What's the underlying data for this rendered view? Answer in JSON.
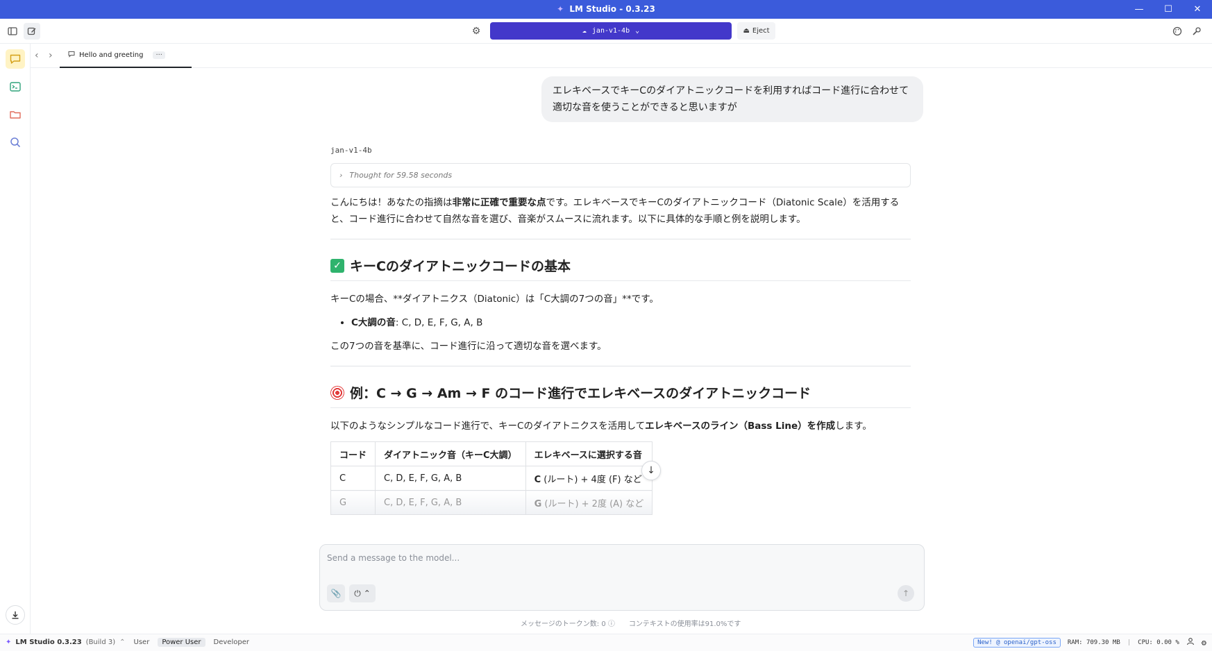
{
  "window": {
    "title": "LM Studio - 0.3.23"
  },
  "toolbar": {
    "model_name": "jan-v1-4b",
    "eject_label": "Eject"
  },
  "tab": {
    "title": "Hello and greeting",
    "more": "···"
  },
  "chat": {
    "user_message": "エレキベースでキーCのダイアトニックコードを利用すればコード進行に合わせて適切な音を使うことができると思いますが",
    "assistant": {
      "model_name": "jan-v1-4b",
      "thought": "Thought for 59.58 seconds",
      "intro_prefix": "こんにちは！あなたの指摘は",
      "intro_bold": "非常に正確で重要な点",
      "intro_suffix": "です。エレキベースでキーCのダイアトニックコード（Diatonic Scale）を活用すると、コード進行に合わせて自然な音を選び、音楽がスムースに流れます。以下に具体的な手順と例を説明します。",
      "section1_title": "キーCのダイアトニックコードの基本",
      "section1_para": "キーCの場合、**ダイアトニクス（Diatonic）は「C大調の7つの音」**です。",
      "bullet_label": "C大調の音",
      "bullet_value": ": C, D, E, F, G, A, B",
      "section1_after": "この7つの音を基準に、コード進行に沿って適切な音を選べます。",
      "section2_title": "例：C → G → Am → F のコード進行でエレキベースのダイアトニックコード",
      "section2_prefix": "以下のようなシンプルなコード進行で、キーCのダイアトニクスを活用して",
      "section2_bold": "エレキベースのライン（Bass Line）を作成",
      "section2_suffix": "します。",
      "table": {
        "headers": [
          "コード",
          "ダイアトニック音（キーC大調）",
          "エレキベースに選択する音"
        ],
        "rows": [
          {
            "chord": "C",
            "notes": "C, D, E, F, G, A, B",
            "pick_bold": "C",
            "pick_rest": " (ルート) + 4度 (F) など"
          },
          {
            "chord": "G",
            "notes": "C, D, E, F, G, A, B",
            "pick_bold": "G",
            "pick_rest": " (ルート) + 2度 (A) など"
          }
        ]
      }
    }
  },
  "composer": {
    "placeholder": "Send a message to the model...",
    "token_count": "メッセージのトークン数: 0",
    "context_usage": "コンテキストの使用率は91.0%です"
  },
  "statusbar": {
    "brand": "LM Studio 0.3.23",
    "build": "(Build 3)",
    "modes": [
      "User",
      "Power User",
      "Developer"
    ],
    "active_mode": "Power User",
    "new_badge": "New! @ openai/gpt-oss",
    "ram": "RAM: 709.30 MB",
    "cpu": "CPU: 0.00 %"
  },
  "colors": {
    "accent": "#4338ca",
    "titlebar": "#3b5bdb"
  }
}
